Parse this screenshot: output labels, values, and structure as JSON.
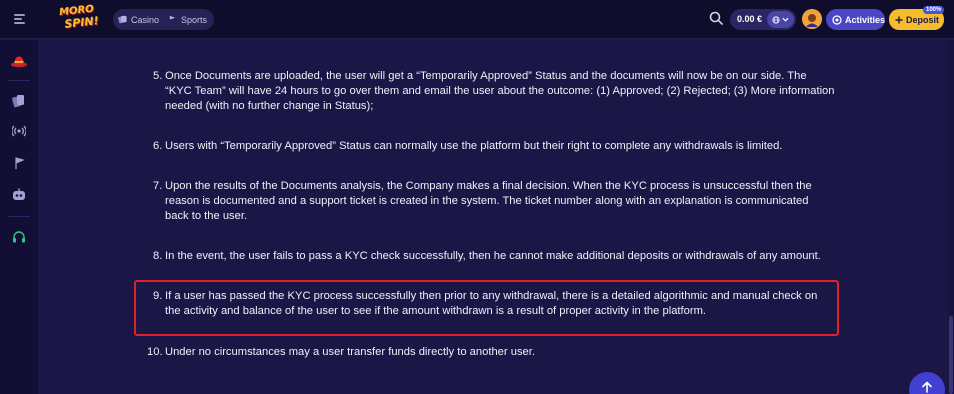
{
  "header": {
    "logo_line1": "MORO",
    "logo_line2": "SPIN!",
    "nav": [
      {
        "label": "Casino",
        "icon": "casino-icon"
      },
      {
        "label": "Sports",
        "icon": "sports-icon"
      }
    ],
    "balance": "0.00 €",
    "activities_label": "Activities",
    "deposit_label": "Deposit",
    "deposit_badge": "100%"
  },
  "sidebar": {
    "icons": [
      "hat-icon",
      "cards-icon",
      "live-icon",
      "flag-icon",
      "robot-icon",
      "headphones-icon"
    ]
  },
  "content": {
    "items": [
      {
        "num": "5.",
        "lines": [
          "Once Documents are uploaded, the user will get a “Temporarily Approved” Status and the documents will now be on our side. The",
          "“KYC Team” will have 24 hours to go over them and email the user about the outcome: (1) Approved; (2) Rejected; (3) More information",
          "needed (with no further change in Status);"
        ]
      },
      {
        "num": "6.",
        "lines": [
          "Users with “Temporarily Approved” Status can normally use the platform but their right to complete any withdrawals is limited."
        ]
      },
      {
        "num": "7.",
        "lines": [
          "Upon the results of the Documents analysis, the Company makes a final decision. When the KYC process is unsuccessful then the",
          "reason is documented and a support ticket is created in the system. The ticket number along with an explanation is communicated",
          "back to the user."
        ]
      },
      {
        "num": "8.",
        "lines": [
          "In the event, the user fails to pass a KYC check successfully, then he cannot make additional deposits or withdrawals of any amount."
        ]
      },
      {
        "num": "9.",
        "lines": [
          "If a user has passed the KYC process successfully then prior to any withdrawal, there is a detailed algorithmic and manual check on",
          "the activity and balance of the user to see if the amount withdrawn is a result of proper activity in the platform."
        ]
      },
      {
        "num": "10.",
        "lines": [
          "Under no circumstances may a user transfer funds directly to another user."
        ]
      }
    ]
  },
  "colors": {
    "background": "#1a1646",
    "highlight_border": "#e0212a",
    "deposit": "#f5bc2c",
    "activities": "#4a46c6"
  }
}
